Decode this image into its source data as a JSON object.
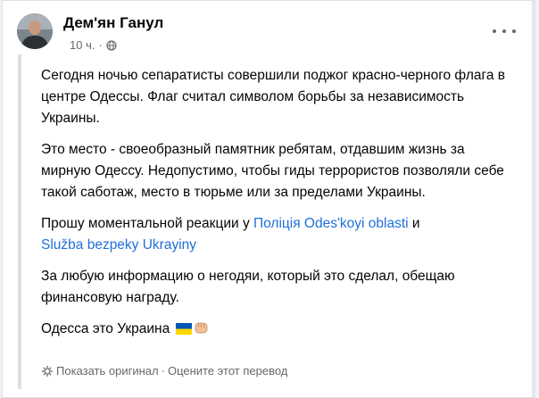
{
  "post": {
    "author": "Дем'ян Ганул",
    "time": "10 ч.",
    "separator": "·",
    "paragraphs": {
      "p1": "Сегодня ночью сепаратисты совершили поджог красно-черного флага в центре Одессы. Флаг считал символом борьбы за независимость Украины.",
      "p2": "Это место - своеобразный памятник ребятам, отдавшим жизнь за мирную Одессу. Недопустимо, чтобы гиды террористов позволяли себе такой саботаж, место в тюрьме или за пределами Украины.",
      "p3_prefix": "Прошу моментальной реакции у ",
      "p3_link1": "Поліція Odes'koyi oblasti",
      "p3_mid": " и ",
      "p3_link2": "Služba bezpeky Ukrayiny",
      "p4": "За любую информацию о негодяи, который это сделал, обещаю финансовую награду.",
      "p5": "Одесса это Украина"
    },
    "translate": {
      "show_original": "Показать оригинал",
      "separator": "·",
      "rate": "Оцените этот перевод"
    }
  },
  "icons": {
    "audience": "globe-icon",
    "more": "more-options-icon",
    "translate": "translate-icon",
    "flag": "ukraine-flag-icon",
    "fist": "fist-icon"
  },
  "colors": {
    "link": "#216fdb",
    "meta": "#65676b",
    "flag_blue": "#0057b7",
    "flag_yellow": "#ffd700"
  }
}
